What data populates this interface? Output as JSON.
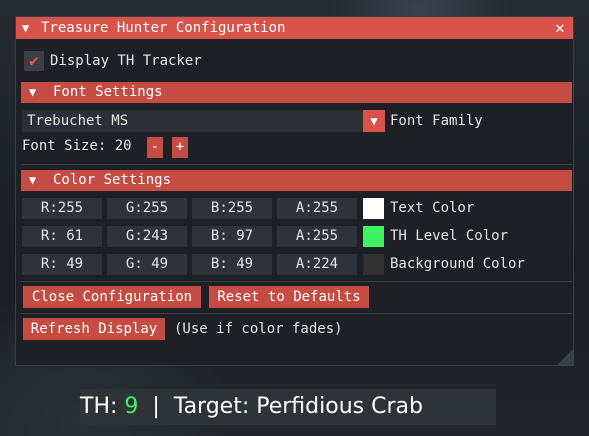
{
  "window": {
    "title": "Treasure Hunter Configuration",
    "close_glyph": "✕"
  },
  "display_tracker": {
    "checked": true,
    "label": "Display TH Tracker"
  },
  "font_settings": {
    "header": "Font Settings",
    "font_family_value": "Trebuchet MS",
    "font_family_label": "Font Family",
    "font_size_label": "Font Size: 20",
    "decrement": "-",
    "increment": "+"
  },
  "color_settings": {
    "header": "Color Settings",
    "rows": [
      {
        "r": "R:255",
        "g": "G:255",
        "b": "B:255",
        "a": "A:255",
        "swatch": "#ffffff",
        "label": "Text Color"
      },
      {
        "r": "R: 61",
        "g": "G:243",
        "b": "B: 97",
        "a": "A:255",
        "swatch": "#3df361",
        "label": "TH Level Color"
      },
      {
        "r": "R: 49",
        "g": "G: 49",
        "b": "B: 49",
        "a": "A:224",
        "swatch": "#313131",
        "label": "Background Color"
      }
    ]
  },
  "buttons": {
    "close_configuration": "Close Configuration",
    "reset_defaults": "Reset to Defaults",
    "refresh_display": "Refresh Display",
    "refresh_hint": "(Use if color fades)"
  },
  "status_bar": {
    "th_label": "TH: ",
    "th_value": "9",
    "separator": "  |  ",
    "target_text": "Target: Perfidious Crab",
    "th_value_color": "#3df361"
  },
  "colors": {
    "accent": "#d9534a",
    "header": "#c44c43",
    "panel": "#1d2126"
  }
}
